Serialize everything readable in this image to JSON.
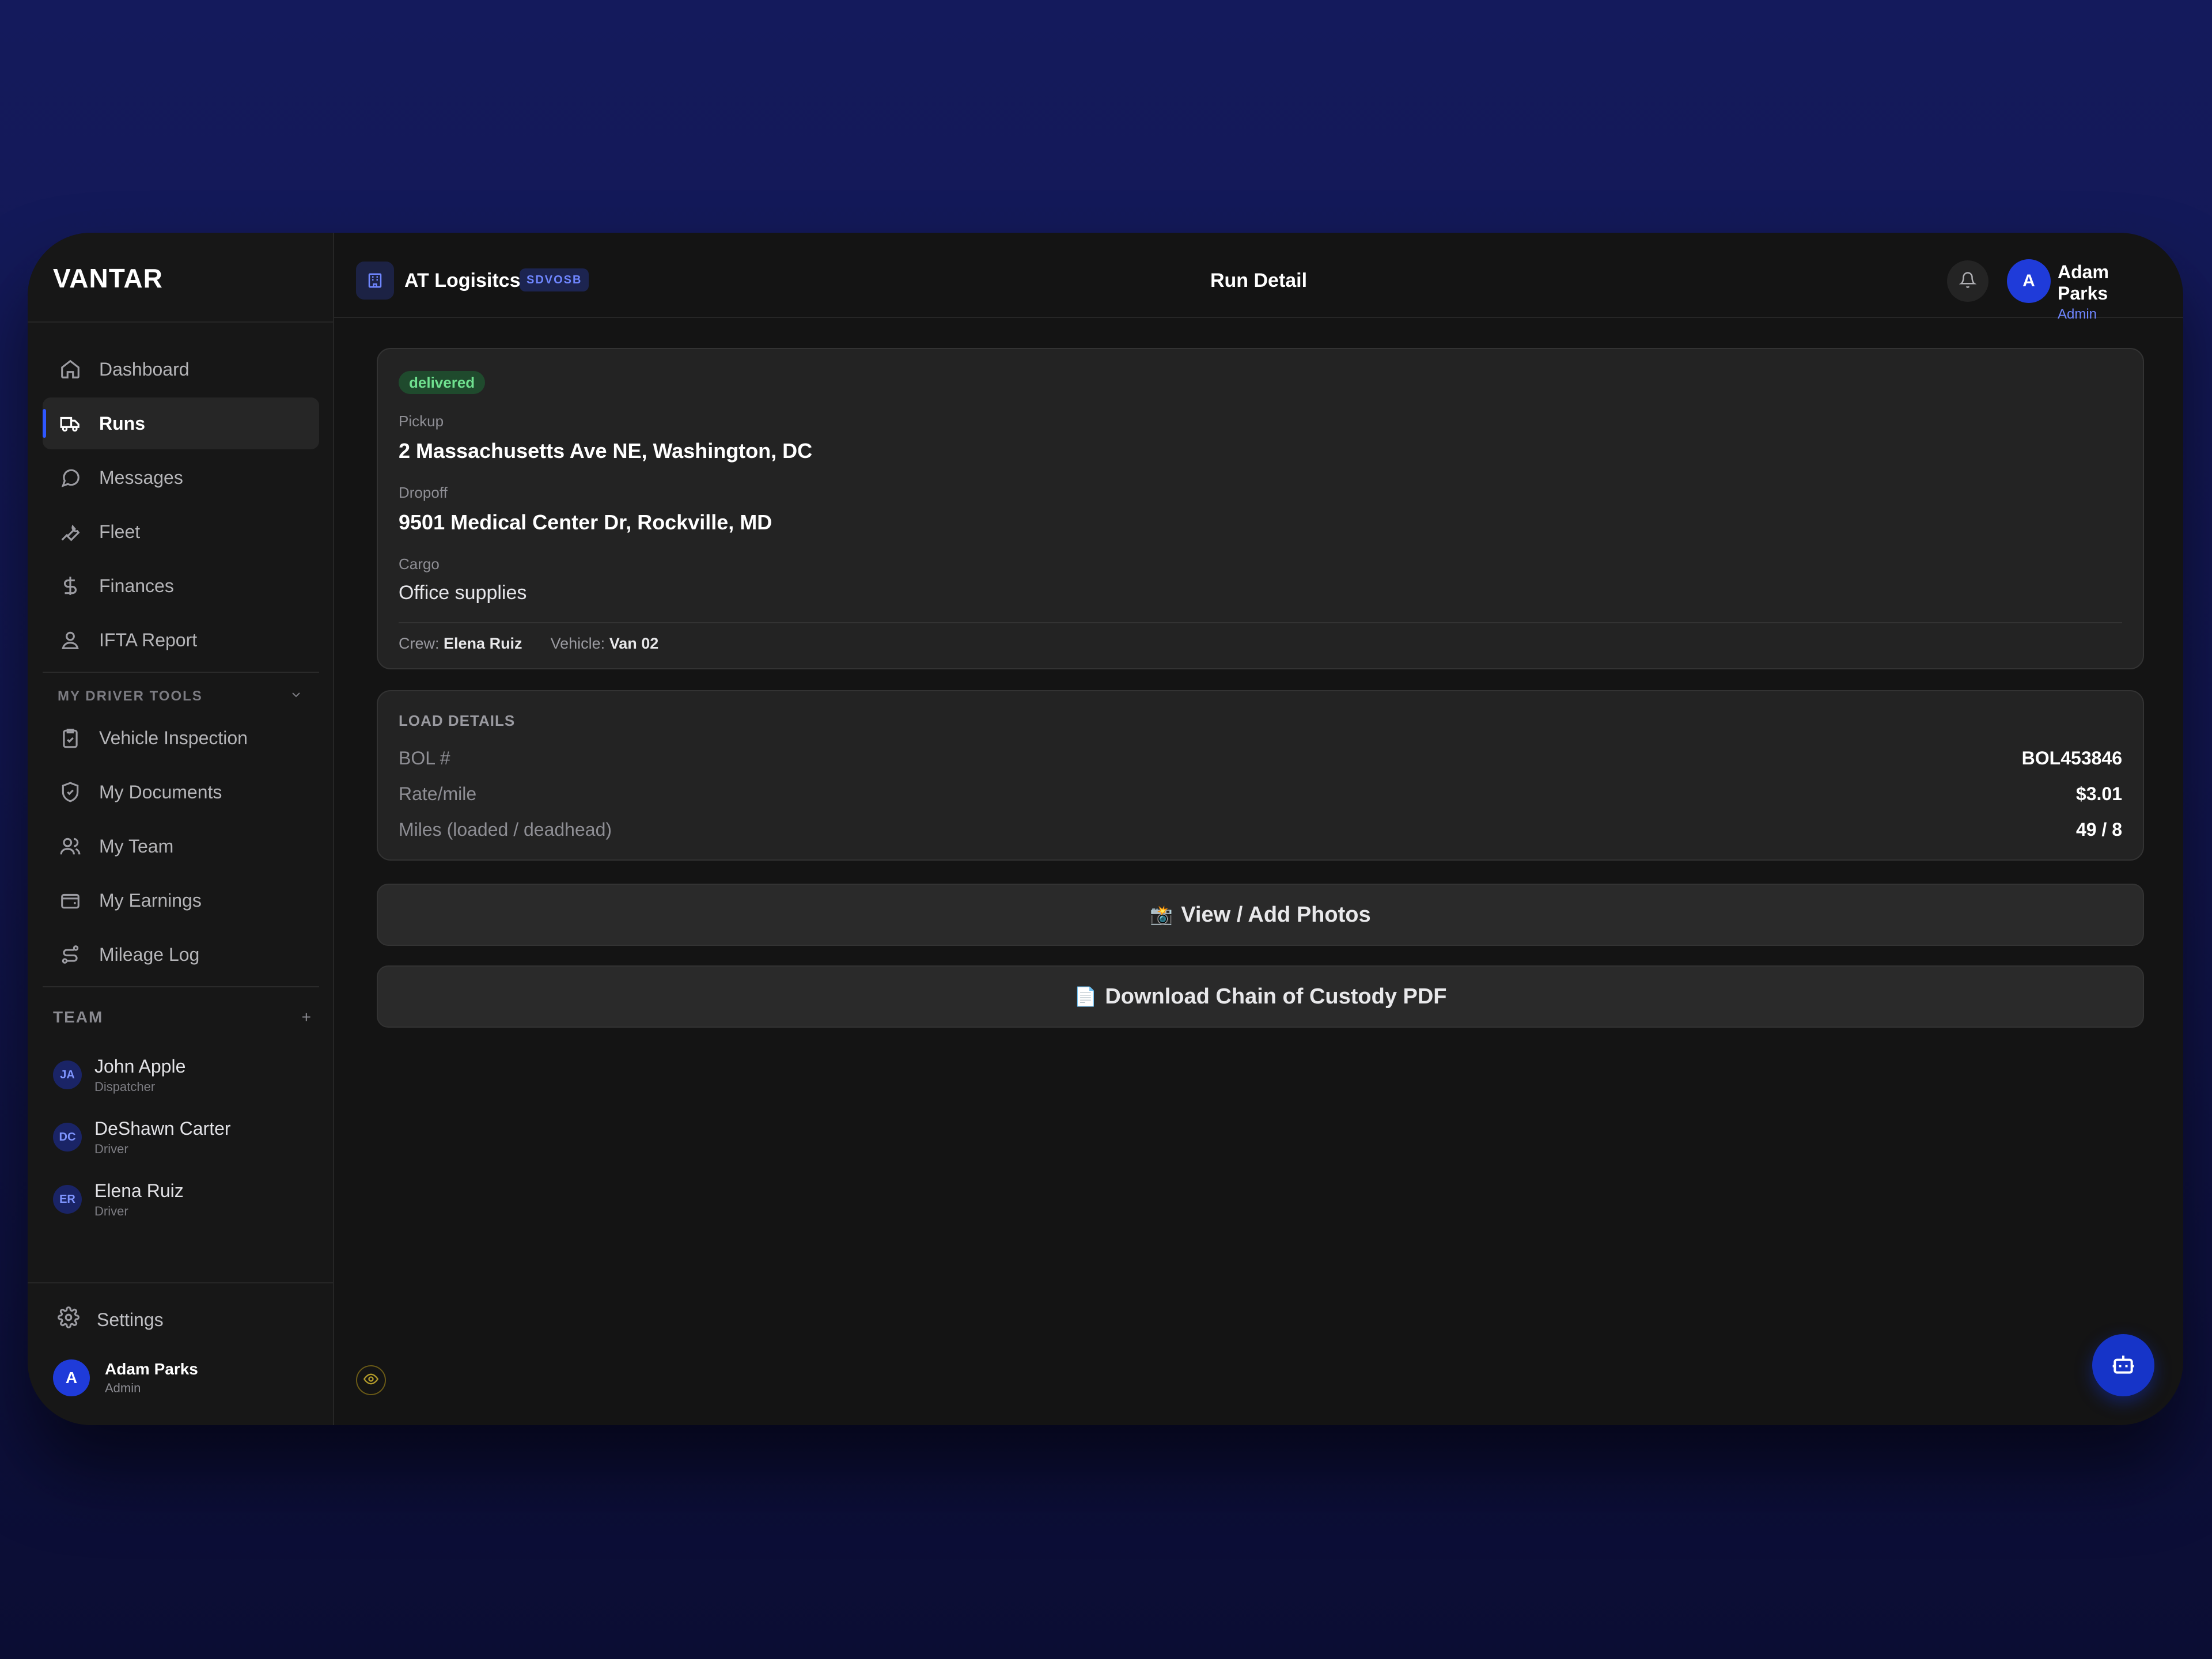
{
  "brand": "VANTAR",
  "nav": {
    "main": [
      {
        "label": "Dashboard",
        "icon": "home-icon"
      },
      {
        "label": "Runs",
        "icon": "truck-icon",
        "active": true
      },
      {
        "label": "Messages",
        "icon": "message-icon"
      },
      {
        "label": "Fleet",
        "icon": "wrench-icon"
      },
      {
        "label": "Finances",
        "icon": "dollar-icon"
      },
      {
        "label": "IFTA Report",
        "icon": "map-pin-user-icon"
      }
    ],
    "driver_tools_heading": "MY DRIVER TOOLS",
    "driver_tools": [
      {
        "label": "Vehicle Inspection",
        "icon": "clipboard-check-icon"
      },
      {
        "label": "My Documents",
        "icon": "shield-check-icon"
      },
      {
        "label": "My Team",
        "icon": "users-icon"
      },
      {
        "label": "My Earnings",
        "icon": "wallet-icon"
      },
      {
        "label": "Mileage Log",
        "icon": "route-icon"
      }
    ]
  },
  "team": {
    "heading": "TEAM",
    "add_symbol": "+",
    "members": [
      {
        "initials": "JA",
        "name": "John Apple",
        "role": "Dispatcher"
      },
      {
        "initials": "DC",
        "name": "DeShawn Carter",
        "role": "Driver"
      },
      {
        "initials": "ER",
        "name": "Elena Ruiz",
        "role": "Driver"
      }
    ]
  },
  "settings_label": "Settings",
  "current_user": {
    "initial": "A",
    "name": "Adam Parks",
    "role": "Admin"
  },
  "header": {
    "org_name": "AT Logisitcs",
    "org_badge": "SDVOSB",
    "page_title": "Run Detail"
  },
  "run": {
    "status": "delivered",
    "pickup_label": "Pickup",
    "pickup": "2 Massachusetts Ave NE, Washington, DC",
    "dropoff_label": "Dropoff",
    "dropoff": "9501 Medical Center Dr, Rockville, MD",
    "cargo_label": "Cargo",
    "cargo": "Office supplies",
    "crew_label": "Crew:",
    "crew": "Elena Ruiz",
    "vehicle_label": "Vehicle:",
    "vehicle": "Van 02"
  },
  "load_details": {
    "title": "LOAD DETAILS",
    "rows": [
      {
        "label": "BOL #",
        "value": "BOL453846"
      },
      {
        "label": "Rate/mile",
        "value": "$3.01"
      },
      {
        "label": "Miles (loaded / deadhead)",
        "value": "49 / 8"
      }
    ]
  },
  "actions": {
    "photos_emoji": "📸",
    "photos_label": "View / Add Photos",
    "pdf_emoji": "📄",
    "pdf_label": "Download Chain of Custody PDF"
  },
  "colors": {
    "accent": "#1f3bd9",
    "status_delivered_bg": "#1f4a2d",
    "status_delivered_text": "#6fe08f",
    "background": "#141414"
  }
}
